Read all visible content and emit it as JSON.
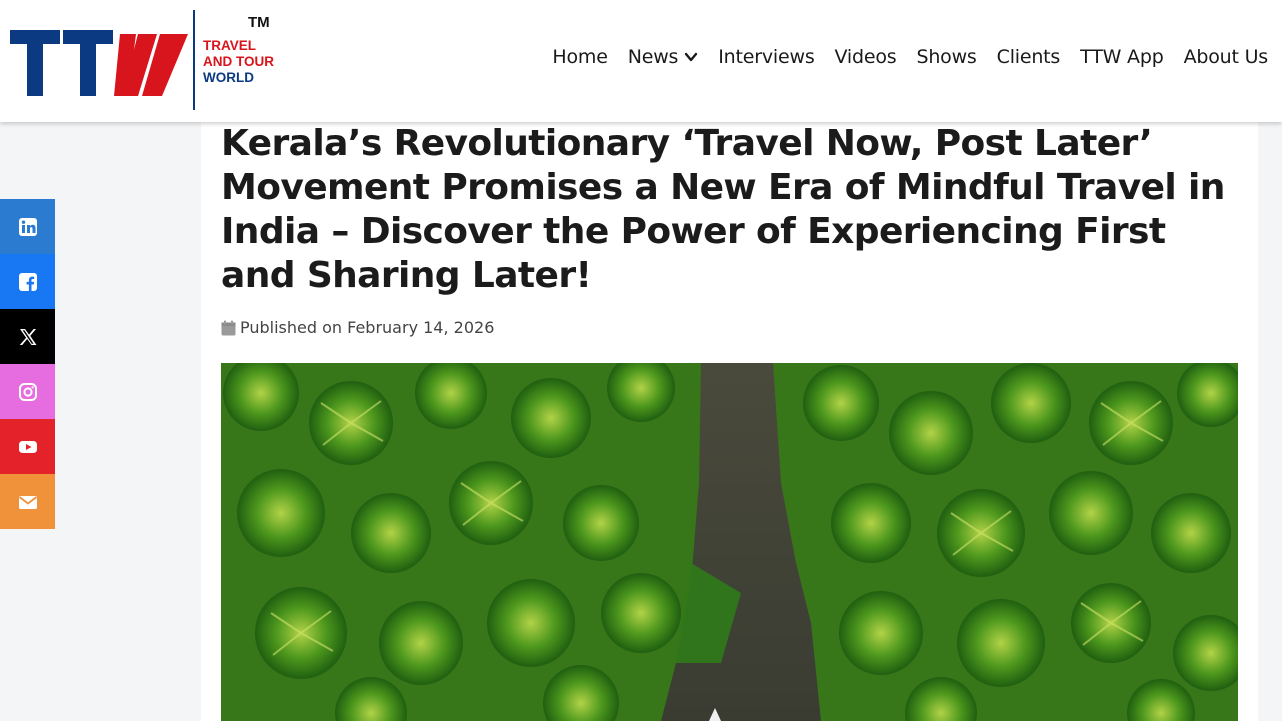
{
  "brand": {
    "logo_letters": "TTW",
    "trademark": "TM",
    "name_line1": "TRAVEL",
    "name_line2": "AND TOUR",
    "name_line3": "WORLD",
    "primary_color": "#0b3a82",
    "accent_color": "#d8141c"
  },
  "nav": {
    "items": [
      {
        "label": "Home"
      },
      {
        "label": "News",
        "icon": "chevron-down-icon"
      },
      {
        "label": "Interviews"
      },
      {
        "label": "Videos"
      },
      {
        "label": "Shows"
      },
      {
        "label": "Clients"
      },
      {
        "label": "TTW App"
      },
      {
        "label": "About Us"
      }
    ]
  },
  "social": [
    {
      "name": "linkedin",
      "icon": "linkedin-icon",
      "color": "#2b7bd0"
    },
    {
      "name": "facebook",
      "icon": "facebook-icon",
      "color": "#1877f2"
    },
    {
      "name": "x",
      "icon": "x-icon",
      "color": "#000000"
    },
    {
      "name": "instagram",
      "icon": "instagram-icon",
      "color": "#e56de0"
    },
    {
      "name": "youtube",
      "icon": "youtube-icon",
      "color": "#e3222a"
    },
    {
      "name": "email",
      "icon": "envelope-icon",
      "color": "#f0923a"
    }
  ],
  "article": {
    "title": "Kerala’s Revolutionary ‘Travel Now, Post Later’ Movement Promises a New Era of Mindful Travel in India – Discover the Power of Experiencing First and Sharing Later!",
    "published": "Published on February 14, 2026",
    "calendar_icon": "calendar-icon",
    "hero_image": "aerial-palm-forest-river-boat"
  }
}
